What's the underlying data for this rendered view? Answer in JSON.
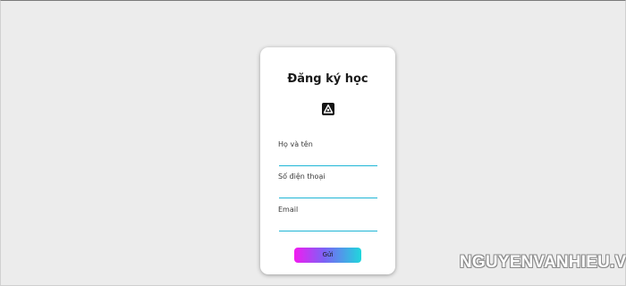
{
  "form": {
    "title": "Đăng ký học",
    "logo_icon": "app-logo-icon",
    "fields": [
      {
        "label": "Họ và tên",
        "value": ""
      },
      {
        "label": "Số điện thoại",
        "value": ""
      },
      {
        "label": "Email",
        "value": ""
      }
    ],
    "submit_label": "Gửi"
  },
  "watermark": "NGUYENVANHIEU.VN",
  "colors": {
    "background": "#ececec",
    "underline": "#1fb6d6",
    "button_gradient_start": "#f21bf0",
    "button_gradient_end": "#1fd7dc"
  }
}
